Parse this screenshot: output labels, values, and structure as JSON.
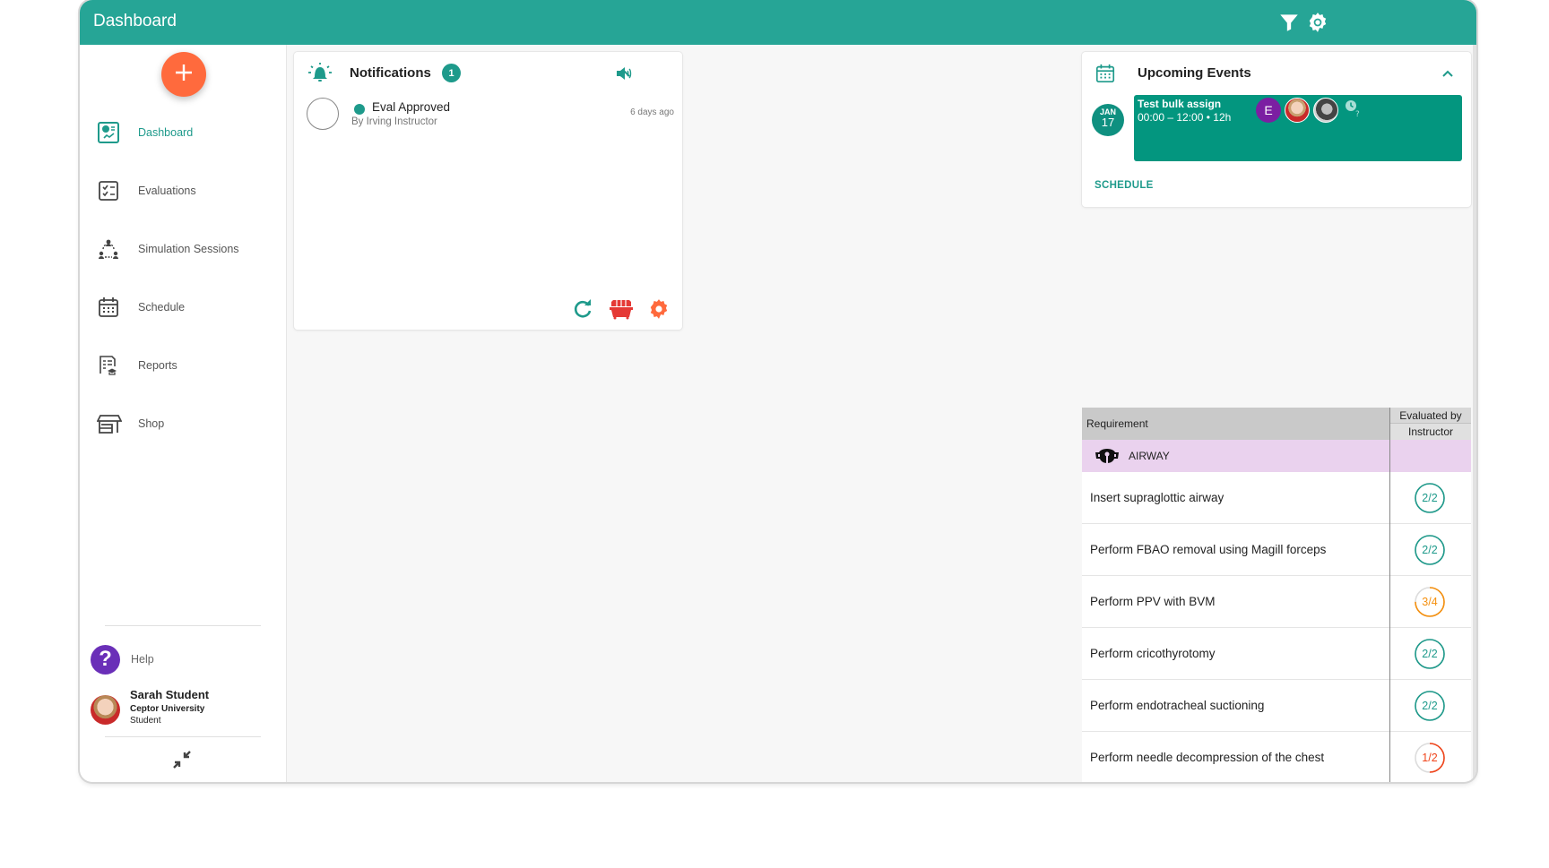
{
  "header": {
    "title": "Dashboard",
    "icons": [
      "filter-icon",
      "settings-gear-icon"
    ]
  },
  "sidebar": {
    "fab_icon": "plus-icon",
    "items": [
      {
        "label": "Dashboard",
        "icon": "dashboard-icon",
        "active": true
      },
      {
        "label": "Evaluations",
        "icon": "checklist-icon",
        "active": false
      },
      {
        "label": "Simulation Sessions",
        "icon": "group-session-icon",
        "active": false
      },
      {
        "label": "Schedule",
        "icon": "calendar-icon",
        "active": false
      },
      {
        "label": "Reports",
        "icon": "report-icon",
        "active": false
      },
      {
        "label": "Shop",
        "icon": "shop-icon",
        "active": false
      }
    ],
    "help_label": "Help",
    "help_icon": "?",
    "user": {
      "name": "Sarah Student",
      "organization": "Ceptor University",
      "role": "Student"
    },
    "collapse_icon": "collapse-arrows-icon"
  },
  "notifications": {
    "title": "Notifications",
    "count": "1",
    "items": [
      {
        "title": "Eval Approved",
        "subtitle": "By Irving Instructor",
        "time": "6 days ago",
        "unread": true
      }
    ],
    "footer_icons": [
      "refresh-icon",
      "dumpster-icon",
      "settings-gear-icon"
    ]
  },
  "upcoming_events": {
    "title": "Upcoming Events",
    "events": [
      {
        "month": "JAN",
        "day": "17",
        "name": "Test bulk assign",
        "time": "00:00 – 12:00 • 12h",
        "participants": [
          "E",
          "Sarah Student",
          "Instructor"
        ],
        "status_icon": "clock-question-icon"
      }
    ],
    "schedule_link": "SCHEDULE"
  },
  "requirements": {
    "col_requirement": "Requirement",
    "col_evaluated_line1": "Evaluated by",
    "col_evaluated_line2": "Instructor",
    "category": {
      "label": "AIRWAY",
      "icon": "airway-mask-icon"
    },
    "rows": [
      {
        "label": "Insert supraglottic airway",
        "done": 2,
        "total": 2,
        "display": "2/2",
        "color": "#1e9a8b"
      },
      {
        "label": "Perform FBAO removal using Magill forceps",
        "done": 2,
        "total": 2,
        "display": "2/2",
        "color": "#1e9a8b"
      },
      {
        "label": "Perform PPV with BVM",
        "done": 3,
        "total": 4,
        "display": "3/4",
        "color": "#f5900e"
      },
      {
        "label": "Perform cricothyrotomy",
        "done": 2,
        "total": 2,
        "display": "2/2",
        "color": "#1e9a8b"
      },
      {
        "label": "Perform endotracheal suctioning",
        "done": 2,
        "total": 2,
        "display": "2/2",
        "color": "#1e9a8b"
      },
      {
        "label": "Perform needle decompression of the chest",
        "done": 1,
        "total": 2,
        "display": "1/2",
        "color": "#f0441a"
      }
    ]
  },
  "colors": {
    "primary": "#26a596",
    "accent": "#ff6a3d",
    "event_block": "#03967f",
    "category_bg": "#ead2ee",
    "help_purple": "#6a2fb8"
  }
}
